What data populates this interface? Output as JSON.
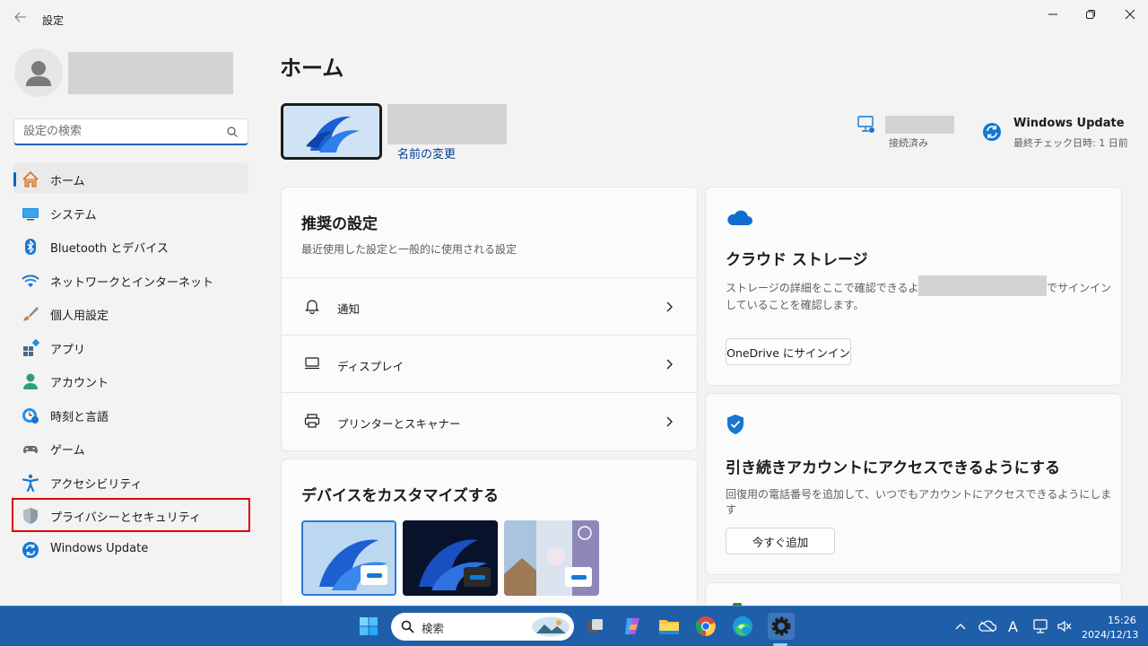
{
  "window": {
    "title": "設定",
    "back_icon": "back-arrow-icon",
    "controls": [
      "minimize-icon",
      "maximize-icon",
      "close-icon"
    ]
  },
  "sidebar": {
    "search_placeholder": "設定の検索",
    "items": [
      {
        "label": "ホーム",
        "icon": "home-icon",
        "active": true
      },
      {
        "label": "システム",
        "icon": "system-icon"
      },
      {
        "label": "Bluetooth とデバイス",
        "icon": "bluetooth-icon"
      },
      {
        "label": "ネットワークとインターネット",
        "icon": "wifi-icon"
      },
      {
        "label": "個人用設定",
        "icon": "brush-icon"
      },
      {
        "label": "アプリ",
        "icon": "apps-icon"
      },
      {
        "label": "アカウント",
        "icon": "account-icon"
      },
      {
        "label": "時刻と言語",
        "icon": "time-language-icon"
      },
      {
        "label": "ゲーム",
        "icon": "gamepad-icon"
      },
      {
        "label": "アクセシビリティ",
        "icon": "accessibility-icon"
      },
      {
        "label": "プライバシーとセキュリティ",
        "icon": "shield-icon",
        "highlighted": true
      },
      {
        "label": "Windows Update",
        "icon": "windows-update-icon"
      }
    ]
  },
  "main": {
    "title": "ホーム",
    "rename_link": "名前の変更",
    "connection_status": "接続済み",
    "windows_update": {
      "title": "Windows Update",
      "subtitle": "最終チェック日時: 1 日前"
    },
    "recommended": {
      "title": "推奨の設定",
      "subtitle": "最近使用した設定と一般的に使用される設定",
      "rows": [
        {
          "label": "通知",
          "icon": "bell-icon"
        },
        {
          "label": "ディスプレイ",
          "icon": "display-icon"
        },
        {
          "label": "プリンターとスキャナー",
          "icon": "printer-icon"
        }
      ]
    },
    "customize": {
      "title": "デバイスをカスタマイズする"
    },
    "cloud": {
      "title": "クラウド ストレージ",
      "desc_part1": "ストレージの詳細をここで確認できるように、",
      "desc_part2": "でサインイン",
      "desc_line2": "していることを確認します。",
      "button": "OneDrive にサインイン"
    },
    "account_access": {
      "title": "引き続きアカウントにアクセスできるようにする",
      "desc": "回復用の電話番号を追加して、いつでもアカウントにアクセスできるようにします",
      "button": "今すぐ追加"
    }
  },
  "taskbar": {
    "search_label": "検索",
    "ime": "A",
    "time": "15:26",
    "date": "2024/12/13"
  },
  "colors": {
    "accent": "#0067c0",
    "taskbar": "#1f5faa",
    "highlight_box": "#e00000"
  }
}
